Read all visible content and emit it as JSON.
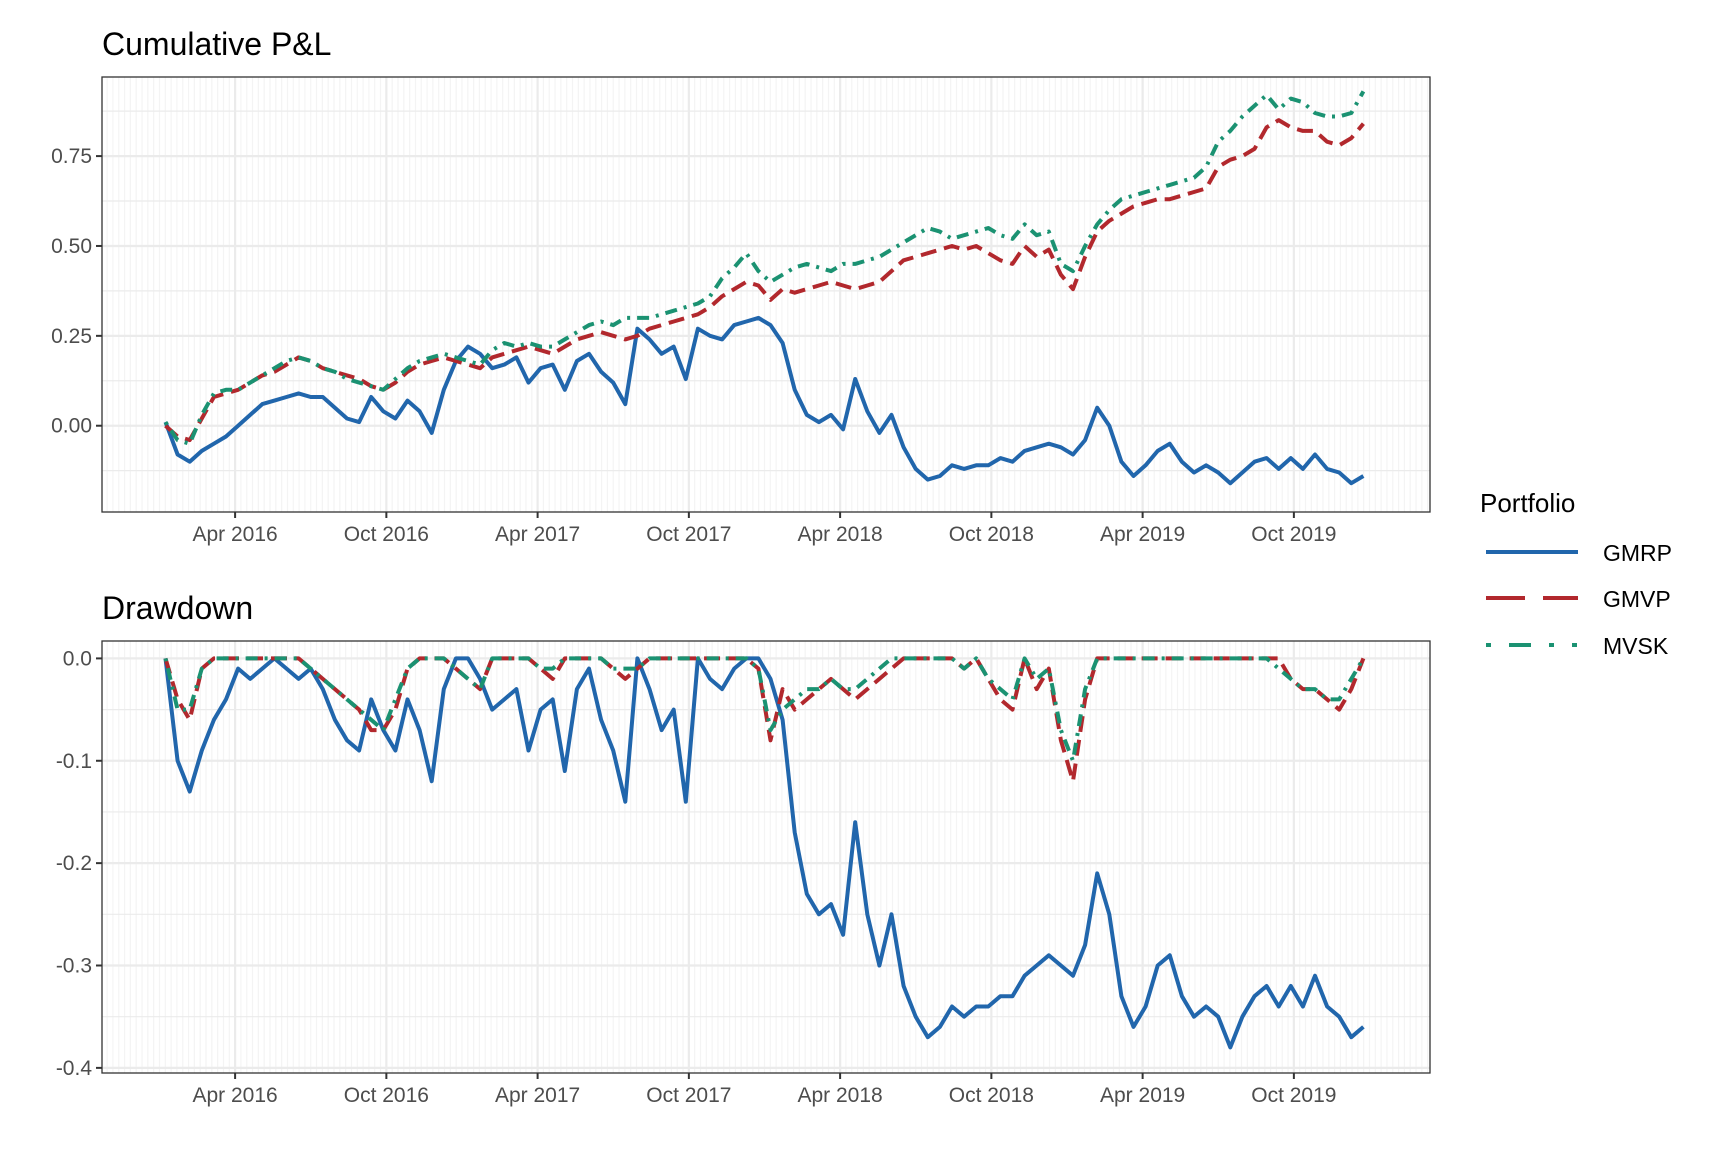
{
  "colors": {
    "GMRP": "#2166ac",
    "GMVP": "#b2282d",
    "MVSK": "#1b9272",
    "grid_major": "#ebebeb",
    "grid_minor": "#f4f4f4",
    "axis": "#333333"
  },
  "legend": {
    "title": "Portfolio",
    "items": [
      "GMRP",
      "GMVP",
      "MVSK"
    ],
    "position": "right"
  },
  "chart_data": [
    {
      "type": "line",
      "title": "Cumulative P&L",
      "xlabel": "",
      "ylabel": "",
      "x_ticks": [
        {
          "label": "Apr 2016",
          "value": 2016.25
        },
        {
          "label": "Oct 2016",
          "value": 2016.75
        },
        {
          "label": "Apr 2017",
          "value": 2017.25
        },
        {
          "label": "Oct 2017",
          "value": 2017.75
        },
        {
          "label": "Apr 2018",
          "value": 2018.25
        },
        {
          "label": "Oct 2018",
          "value": 2018.75
        },
        {
          "label": "Apr 2019",
          "value": 2019.25
        },
        {
          "label": "Oct 2019",
          "value": 2019.75
        }
      ],
      "y_ticks": [
        {
          "label": "0.00",
          "value": 0
        },
        {
          "label": "0.25",
          "value": 0.25
        },
        {
          "label": "0.50",
          "value": 0.5
        },
        {
          "label": "0.75",
          "value": 0.75
        }
      ],
      "xlim": [
        2015.81,
        2020.2
      ],
      "ylim": [
        -0.24,
        0.97
      ],
      "grid": true,
      "x": [
        2016.02,
        2016.06,
        2016.1,
        2016.14,
        2016.18,
        2016.22,
        2016.26,
        2016.3,
        2016.34,
        2016.38,
        2016.42,
        2016.46,
        2016.5,
        2016.54,
        2016.58,
        2016.62,
        2016.66,
        2016.7,
        2016.74,
        2016.78,
        2016.82,
        2016.86,
        2016.9,
        2016.94,
        2016.98,
        2017.02,
        2017.06,
        2017.1,
        2017.14,
        2017.18,
        2017.22,
        2017.26,
        2017.3,
        2017.34,
        2017.38,
        2017.42,
        2017.46,
        2017.5,
        2017.54,
        2017.58,
        2017.62,
        2017.66,
        2017.7,
        2017.74,
        2017.78,
        2017.82,
        2017.86,
        2017.9,
        2017.94,
        2017.98,
        2018.02,
        2018.06,
        2018.1,
        2018.14,
        2018.18,
        2018.22,
        2018.26,
        2018.3,
        2018.34,
        2018.38,
        2018.42,
        2018.46,
        2018.5,
        2018.54,
        2018.58,
        2018.62,
        2018.66,
        2018.7,
        2018.74,
        2018.78,
        2018.82,
        2018.86,
        2018.9,
        2018.94,
        2018.98,
        2019.02,
        2019.06,
        2019.1,
        2019.14,
        2019.18,
        2019.22,
        2019.26,
        2019.3,
        2019.34,
        2019.38,
        2019.42,
        2019.46,
        2019.5,
        2019.54,
        2019.58,
        2019.62,
        2019.66,
        2019.7,
        2019.74,
        2019.78,
        2019.82,
        2019.86,
        2019.9,
        2019.94,
        2019.98
      ],
      "series": [
        {
          "name": "GMRP",
          "values": [
            0.01,
            -0.08,
            -0.1,
            -0.07,
            -0.05,
            -0.03,
            0.0,
            0.03,
            0.06,
            0.07,
            0.08,
            0.09,
            0.08,
            0.08,
            0.05,
            0.02,
            0.01,
            0.08,
            0.04,
            0.02,
            0.07,
            0.04,
            -0.02,
            0.1,
            0.18,
            0.22,
            0.2,
            0.16,
            0.17,
            0.19,
            0.12,
            0.16,
            0.17,
            0.1,
            0.18,
            0.2,
            0.15,
            0.12,
            0.06,
            0.27,
            0.24,
            0.2,
            0.22,
            0.13,
            0.27,
            0.25,
            0.24,
            0.28,
            0.29,
            0.3,
            0.28,
            0.23,
            0.1,
            0.03,
            0.01,
            0.03,
            -0.01,
            0.13,
            0.04,
            -0.02,
            0.03,
            -0.06,
            -0.12,
            -0.15,
            -0.14,
            -0.11,
            -0.12,
            -0.11,
            -0.11,
            -0.09,
            -0.1,
            -0.07,
            -0.06,
            -0.05,
            -0.06,
            -0.08,
            -0.04,
            0.05,
            0.0,
            -0.1,
            -0.14,
            -0.11,
            -0.07,
            -0.05,
            -0.1,
            -0.13,
            -0.11,
            -0.13,
            -0.16,
            -0.13,
            -0.1,
            -0.09,
            -0.12,
            -0.09,
            -0.12,
            -0.08,
            -0.12,
            -0.13,
            -0.16,
            -0.14
          ]
        },
        {
          "name": "GMVP",
          "values": [
            0.0,
            -0.03,
            -0.04,
            0.02,
            0.08,
            0.09,
            0.1,
            0.12,
            0.14,
            0.15,
            0.17,
            0.19,
            0.18,
            0.16,
            0.15,
            0.14,
            0.13,
            0.11,
            0.1,
            0.12,
            0.15,
            0.17,
            0.18,
            0.19,
            0.18,
            0.17,
            0.16,
            0.19,
            0.2,
            0.21,
            0.22,
            0.21,
            0.2,
            0.22,
            0.24,
            0.25,
            0.26,
            0.25,
            0.24,
            0.25,
            0.27,
            0.28,
            0.29,
            0.3,
            0.31,
            0.33,
            0.36,
            0.38,
            0.4,
            0.39,
            0.35,
            0.38,
            0.37,
            0.38,
            0.39,
            0.4,
            0.39,
            0.38,
            0.39,
            0.4,
            0.43,
            0.46,
            0.47,
            0.48,
            0.49,
            0.5,
            0.49,
            0.5,
            0.48,
            0.46,
            0.45,
            0.5,
            0.47,
            0.49,
            0.42,
            0.38,
            0.47,
            0.54,
            0.57,
            0.59,
            0.61,
            0.62,
            0.63,
            0.63,
            0.64,
            0.65,
            0.66,
            0.72,
            0.74,
            0.75,
            0.77,
            0.83,
            0.85,
            0.83,
            0.82,
            0.82,
            0.79,
            0.78,
            0.8,
            0.84
          ]
        },
        {
          "name": "MVSK",
          "values": [
            0.01,
            -0.04,
            -0.05,
            0.03,
            0.09,
            0.1,
            0.1,
            0.12,
            0.14,
            0.16,
            0.18,
            0.19,
            0.18,
            0.16,
            0.15,
            0.13,
            0.12,
            0.11,
            0.1,
            0.13,
            0.16,
            0.18,
            0.19,
            0.2,
            0.19,
            0.18,
            0.17,
            0.21,
            0.23,
            0.22,
            0.23,
            0.22,
            0.22,
            0.24,
            0.26,
            0.28,
            0.29,
            0.28,
            0.3,
            0.3,
            0.3,
            0.31,
            0.32,
            0.33,
            0.34,
            0.36,
            0.41,
            0.44,
            0.48,
            0.43,
            0.4,
            0.42,
            0.44,
            0.45,
            0.44,
            0.43,
            0.45,
            0.45,
            0.46,
            0.47,
            0.49,
            0.51,
            0.53,
            0.55,
            0.54,
            0.52,
            0.53,
            0.54,
            0.55,
            0.53,
            0.52,
            0.56,
            0.53,
            0.54,
            0.45,
            0.43,
            0.5,
            0.56,
            0.6,
            0.63,
            0.64,
            0.65,
            0.66,
            0.67,
            0.68,
            0.69,
            0.72,
            0.79,
            0.82,
            0.86,
            0.89,
            0.92,
            0.88,
            0.91,
            0.9,
            0.87,
            0.86,
            0.86,
            0.87,
            0.93
          ]
        }
      ]
    },
    {
      "type": "line",
      "title": "Drawdown",
      "xlabel": "",
      "ylabel": "",
      "x_ticks": [
        {
          "label": "Apr 2016",
          "value": 2016.25
        },
        {
          "label": "Oct 2016",
          "value": 2016.75
        },
        {
          "label": "Apr 2017",
          "value": 2017.25
        },
        {
          "label": "Oct 2017",
          "value": 2017.75
        },
        {
          "label": "Apr 2018",
          "value": 2018.25
        },
        {
          "label": "Oct 2018",
          "value": 2018.75
        },
        {
          "label": "Apr 2019",
          "value": 2019.25
        },
        {
          "label": "Oct 2019",
          "value": 2019.75
        }
      ],
      "y_ticks": [
        {
          "label": "0.0",
          "value": 0
        },
        {
          "label": "-0.1",
          "value": -0.1
        },
        {
          "label": "-0.2",
          "value": -0.2
        },
        {
          "label": "-0.3",
          "value": -0.3
        },
        {
          "label": "-0.4",
          "value": -0.4
        }
      ],
      "xlim": [
        2015.81,
        2020.2
      ],
      "ylim": [
        -0.405,
        0.017
      ],
      "grid": true,
      "x": [
        2016.02,
        2016.06,
        2016.1,
        2016.14,
        2016.18,
        2016.22,
        2016.26,
        2016.3,
        2016.34,
        2016.38,
        2016.42,
        2016.46,
        2016.5,
        2016.54,
        2016.58,
        2016.62,
        2016.66,
        2016.7,
        2016.74,
        2016.78,
        2016.82,
        2016.86,
        2016.9,
        2016.94,
        2016.98,
        2017.02,
        2017.06,
        2017.1,
        2017.14,
        2017.18,
        2017.22,
        2017.26,
        2017.3,
        2017.34,
        2017.38,
        2017.42,
        2017.46,
        2017.5,
        2017.54,
        2017.58,
        2017.62,
        2017.66,
        2017.7,
        2017.74,
        2017.78,
        2017.82,
        2017.86,
        2017.9,
        2017.94,
        2017.98,
        2018.02,
        2018.06,
        2018.1,
        2018.14,
        2018.18,
        2018.22,
        2018.26,
        2018.3,
        2018.34,
        2018.38,
        2018.42,
        2018.46,
        2018.5,
        2018.54,
        2018.58,
        2018.62,
        2018.66,
        2018.7,
        2018.74,
        2018.78,
        2018.82,
        2018.86,
        2018.9,
        2018.94,
        2018.98,
        2019.02,
        2019.06,
        2019.1,
        2019.14,
        2019.18,
        2019.22,
        2019.26,
        2019.3,
        2019.34,
        2019.38,
        2019.42,
        2019.46,
        2019.5,
        2019.54,
        2019.58,
        2019.62,
        2019.66,
        2019.7,
        2019.74,
        2019.78,
        2019.82,
        2019.86,
        2019.9,
        2019.94,
        2019.98
      ],
      "series": [
        {
          "name": "GMRP",
          "values": [
            0.0,
            -0.1,
            -0.13,
            -0.09,
            -0.06,
            -0.04,
            -0.01,
            -0.02,
            -0.01,
            0.0,
            -0.01,
            -0.02,
            -0.01,
            -0.03,
            -0.06,
            -0.08,
            -0.09,
            -0.04,
            -0.07,
            -0.09,
            -0.04,
            -0.07,
            -0.12,
            -0.03,
            0.0,
            0.0,
            -0.02,
            -0.05,
            -0.04,
            -0.03,
            -0.09,
            -0.05,
            -0.04,
            -0.11,
            -0.03,
            -0.01,
            -0.06,
            -0.09,
            -0.14,
            0.0,
            -0.03,
            -0.07,
            -0.05,
            -0.14,
            0.0,
            -0.02,
            -0.03,
            -0.01,
            0.0,
            0.0,
            -0.02,
            -0.06,
            -0.17,
            -0.23,
            -0.25,
            -0.24,
            -0.27,
            -0.16,
            -0.25,
            -0.3,
            -0.25,
            -0.32,
            -0.35,
            -0.37,
            -0.36,
            -0.34,
            -0.35,
            -0.34,
            -0.34,
            -0.33,
            -0.33,
            -0.31,
            -0.3,
            -0.29,
            -0.3,
            -0.31,
            -0.28,
            -0.21,
            -0.25,
            -0.33,
            -0.36,
            -0.34,
            -0.3,
            -0.29,
            -0.33,
            -0.35,
            -0.34,
            -0.35,
            -0.38,
            -0.35,
            -0.33,
            -0.32,
            -0.34,
            -0.32,
            -0.34,
            -0.31,
            -0.34,
            -0.35,
            -0.37,
            -0.36
          ]
        },
        {
          "name": "GMVP",
          "values": [
            0.0,
            -0.04,
            -0.06,
            -0.01,
            0.0,
            0.0,
            0.0,
            0.0,
            0.0,
            0.0,
            0.0,
            0.0,
            -0.01,
            -0.02,
            -0.03,
            -0.04,
            -0.05,
            -0.07,
            -0.07,
            -0.05,
            -0.01,
            0.0,
            0.0,
            0.0,
            -0.01,
            -0.02,
            -0.03,
            0.0,
            0.0,
            0.0,
            0.0,
            -0.01,
            -0.02,
            0.0,
            0.0,
            0.0,
            0.0,
            -0.01,
            -0.02,
            -0.01,
            0.0,
            0.0,
            0.0,
            0.0,
            0.0,
            0.0,
            0.0,
            0.0,
            0.0,
            -0.01,
            -0.08,
            -0.03,
            -0.05,
            -0.04,
            -0.03,
            -0.02,
            -0.03,
            -0.04,
            -0.03,
            -0.02,
            -0.01,
            0.0,
            0.0,
            0.0,
            0.0,
            0.0,
            -0.01,
            0.0,
            -0.02,
            -0.04,
            -0.05,
            0.0,
            -0.03,
            -0.01,
            -0.08,
            -0.12,
            -0.04,
            0.0,
            0.0,
            0.0,
            0.0,
            0.0,
            0.0,
            0.0,
            0.0,
            0.0,
            0.0,
            0.0,
            0.0,
            0.0,
            0.0,
            0.0,
            0.0,
            -0.02,
            -0.03,
            -0.03,
            -0.04,
            -0.05,
            -0.03,
            0.0
          ]
        },
        {
          "name": "MVSK",
          "values": [
            0.0,
            -0.05,
            -0.05,
            -0.01,
            0.0,
            0.0,
            0.0,
            0.0,
            0.0,
            0.0,
            0.0,
            0.0,
            -0.01,
            -0.02,
            -0.03,
            -0.04,
            -0.05,
            -0.06,
            -0.07,
            -0.04,
            -0.01,
            0.0,
            0.0,
            0.0,
            -0.01,
            -0.02,
            -0.03,
            0.0,
            0.0,
            0.0,
            0.0,
            -0.01,
            -0.01,
            0.0,
            0.0,
            0.0,
            0.0,
            -0.01,
            -0.01,
            -0.01,
            0.0,
            0.0,
            0.0,
            0.0,
            0.0,
            0.0,
            0.0,
            0.0,
            0.0,
            -0.01,
            -0.07,
            -0.05,
            -0.04,
            -0.03,
            -0.03,
            -0.02,
            -0.03,
            -0.03,
            -0.02,
            -0.01,
            0.0,
            0.0,
            0.0,
            0.0,
            0.0,
            0.0,
            -0.01,
            0.0,
            -0.02,
            -0.03,
            -0.04,
            0.0,
            -0.02,
            -0.01,
            -0.07,
            -0.1,
            -0.03,
            0.0,
            0.0,
            0.0,
            0.0,
            0.0,
            0.0,
            0.0,
            0.0,
            0.0,
            0.0,
            0.0,
            0.0,
            0.0,
            0.0,
            0.0,
            -0.01,
            -0.02,
            -0.03,
            -0.03,
            -0.04,
            -0.04,
            -0.02,
            0.0
          ]
        }
      ]
    }
  ]
}
